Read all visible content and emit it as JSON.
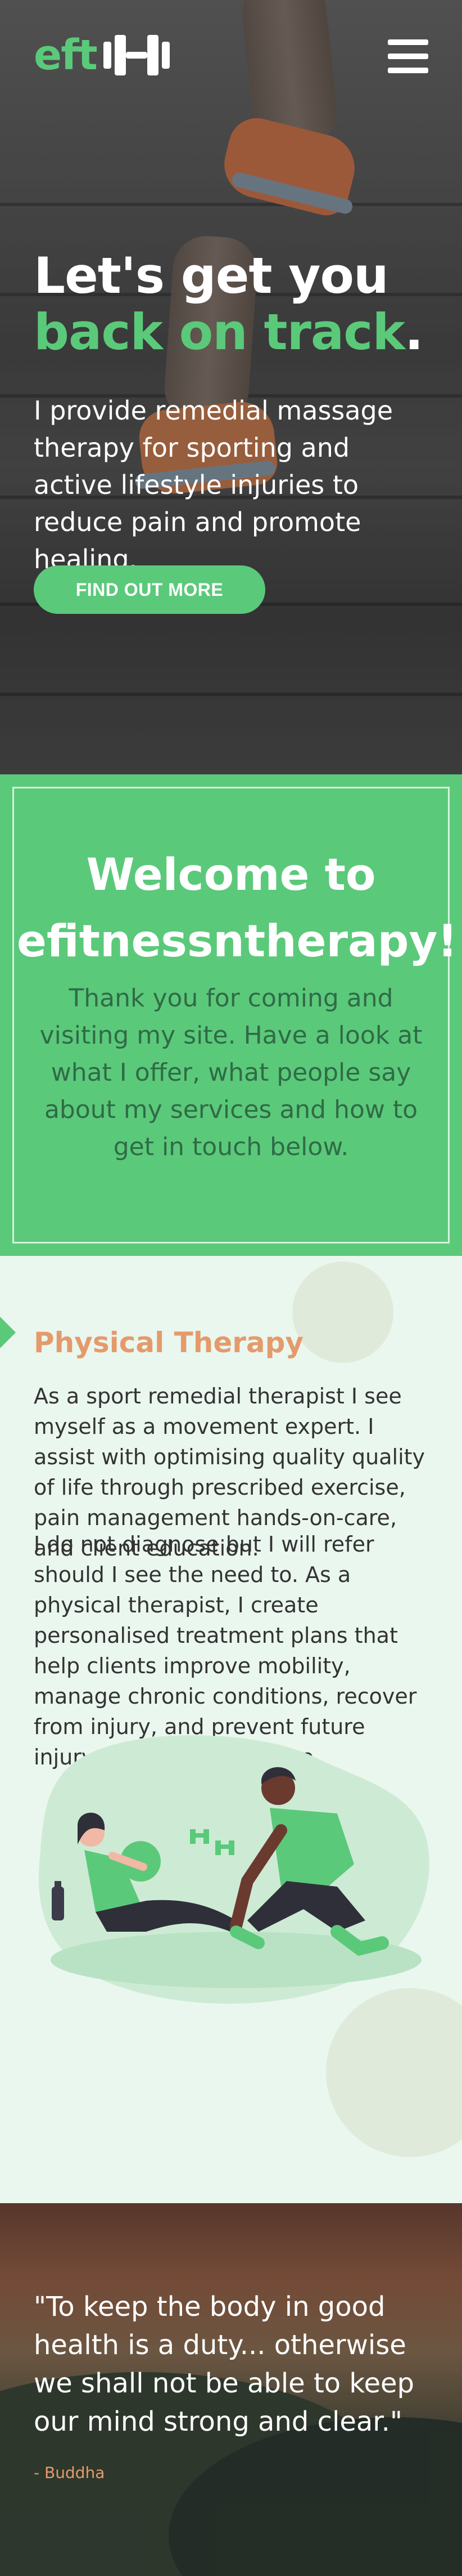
{
  "brand": {
    "logo_text": "eft",
    "logo_icon": "dumbbell-icon",
    "menu_icon": "hamburger-icon"
  },
  "hero": {
    "title_line1": "Let's get you",
    "title_line2": "back on track",
    "title_period": ".",
    "description": "I provide remedial massage therapy for sporting and active lifestyle injuries to reduce pain and promote healing.",
    "button_label": "FIND OUT MORE"
  },
  "welcome": {
    "title": "Welcome to efitnessntherapy!",
    "text": "Thank you for coming and visiting my site. Have a look at what I offer, what people say about my services and how to get in touch below."
  },
  "therapy": {
    "title": "Physical Therapy",
    "paragraph1": "As a sport remedial therapist I see myself as a movement expert. I assist with optimising quality quality of life through prescribed exercise, pain management hands-on-care, and client education.",
    "paragraph2": "I do not diagnose but I will refer should I see the need to. As a physical therapist, I create personalised treatment plans that help clients improve mobility, manage chronic conditions, recover from injury, and prevent future injury and chronic disease."
  },
  "quote": {
    "text": "\"To keep the body in good health is a duty... otherwise we shall not be able to keep our mind strong and clear.\"",
    "author": "- Buddha"
  },
  "colors": {
    "accent": "#5bc97a",
    "orange": "#e59a6b",
    "mint_bg": "#eaf7ee",
    "dark_green_text": "#2f6b46"
  }
}
